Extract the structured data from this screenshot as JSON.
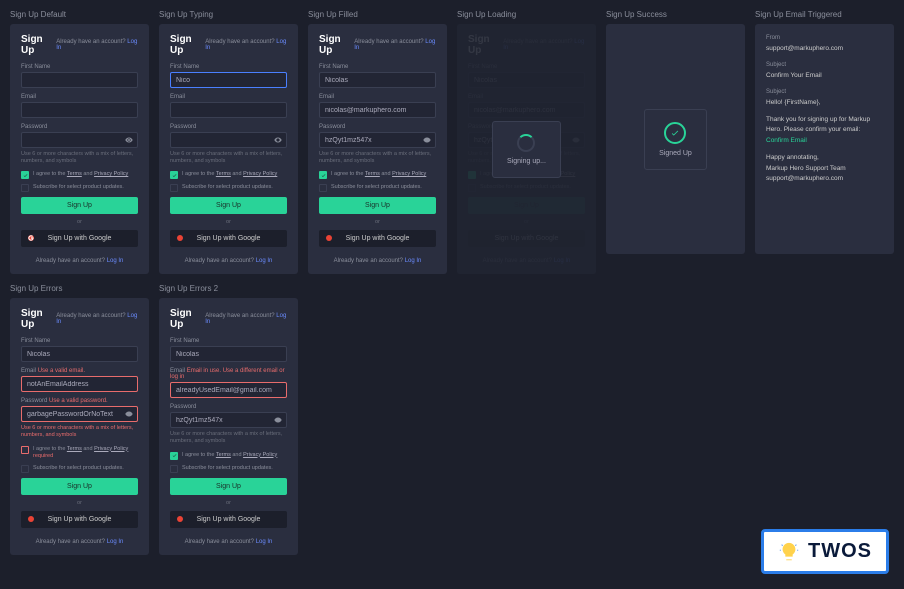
{
  "frames": {
    "default": {
      "label": "Sign Up Default"
    },
    "typing": {
      "label": "Sign Up Typing"
    },
    "filled": {
      "label": "Sign Up Filled"
    },
    "loading": {
      "label": "Sign Up Loading",
      "modal": "Signing up..."
    },
    "success": {
      "label": "Sign Up Success",
      "modal": "Signed Up"
    },
    "email": {
      "label": "Sign Up Email Triggered"
    },
    "errors": {
      "label": "Sign Up Errors"
    },
    "errors2": {
      "label": "Sign Up Errors 2"
    }
  },
  "common": {
    "title": "Sign Up",
    "already": "Already have an account?",
    "login_link": "Log In",
    "firstname_label": "First Name",
    "email_label": "Email",
    "password_label": "Password",
    "pw_hint": "Use 6 or more characters with a mix of letters, numbers, and symbols",
    "terms_text": "I agree to the ",
    "terms_link": "Terms",
    "and": " and ",
    "privacy_link": "Privacy Policy",
    "subscribe_text": "Subscribe for select product updates.",
    "signup_btn": "Sign Up",
    "or": "or",
    "google_btn": "Sign Up with Google",
    "footer": "Already have an account? ",
    "required": " required"
  },
  "values": {
    "firstname": "Nicolas",
    "firstname_partial": "Nico",
    "email_filled": "nicolas@markuphero.com",
    "pw_filled": "hzQyt1mz547x",
    "email_bad": "notAnEmailAddress",
    "pw_bad": "garbagePasswordOrNoText",
    "email_used": "alreadyUsedEmail@gmail.com"
  },
  "errors": {
    "email_invalid": "Use a valid email.",
    "pw_invalid": "Use a valid password.",
    "pw_hint_err": "Use 6 or more characters with a mix of letters, numbers, and symbols",
    "email_in_use": "Email in use. Use a different email or log in"
  },
  "email_content": {
    "from_label": "From",
    "from": "support@markuphero.com",
    "subject_label": "Subject",
    "subject": "Confirm Your Email",
    "body_label": "Subject",
    "greeting": "Hello! {FirstName},",
    "body1": "Thank you for signing up for Markup Hero. Please confirm your email:",
    "confirm_link": "Confirm Email",
    "body2": "Happy annotating,",
    "sig1": "Markup Hero Support Team",
    "sig2": "support@markuphero.com"
  },
  "twos": {
    "text": "TWOS"
  }
}
